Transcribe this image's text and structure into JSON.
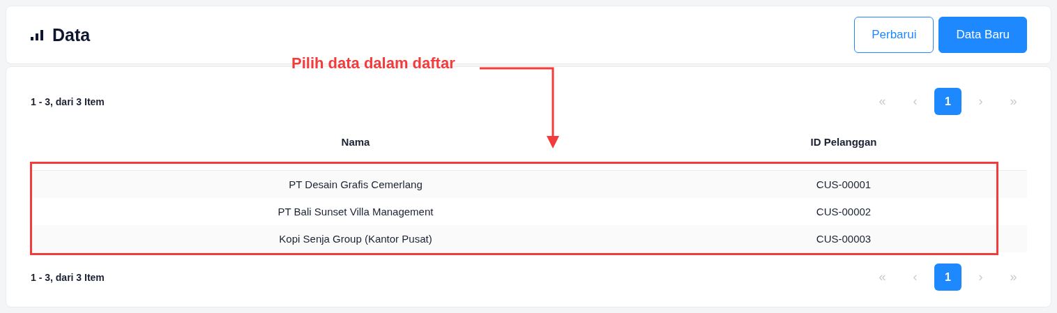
{
  "header": {
    "title": "Data",
    "buttons": [
      {
        "label": "Perbarui",
        "kind": "outline"
      },
      {
        "label": "Data Baru",
        "kind": "primary"
      }
    ]
  },
  "pagination_top": {
    "summary": "1 - 3, dari 3 Item",
    "pages": [
      {
        "label": "«",
        "selected": false
      },
      {
        "label": "‹",
        "selected": false
      },
      {
        "label": "1",
        "selected": true
      },
      {
        "label": "›",
        "selected": false
      },
      {
        "label": "»",
        "selected": false
      }
    ]
  },
  "table": {
    "columns": [
      "Nama",
      "ID Pelanggan"
    ],
    "rows": [
      {
        "cells": [
          "PT Desain Grafis Cemerlang",
          "CUS-00001"
        ]
      },
      {
        "cells": [
          "PT Bali Sunset Villa Management",
          "CUS-00002"
        ]
      },
      {
        "cells": [
          "Kopi Senja Group (Kantor Pusat)",
          "CUS-00003"
        ]
      }
    ]
  },
  "pagination_bottom": {
    "summary": "1 - 3, dari 3 Item",
    "pages": [
      {
        "label": "«",
        "selected": false
      },
      {
        "label": "‹",
        "selected": false
      },
      {
        "label": "1",
        "selected": true
      },
      {
        "label": "›",
        "selected": false
      },
      {
        "label": "»",
        "selected": false
      }
    ]
  },
  "annotation": {
    "label": "Pilih data dalam daftar"
  }
}
